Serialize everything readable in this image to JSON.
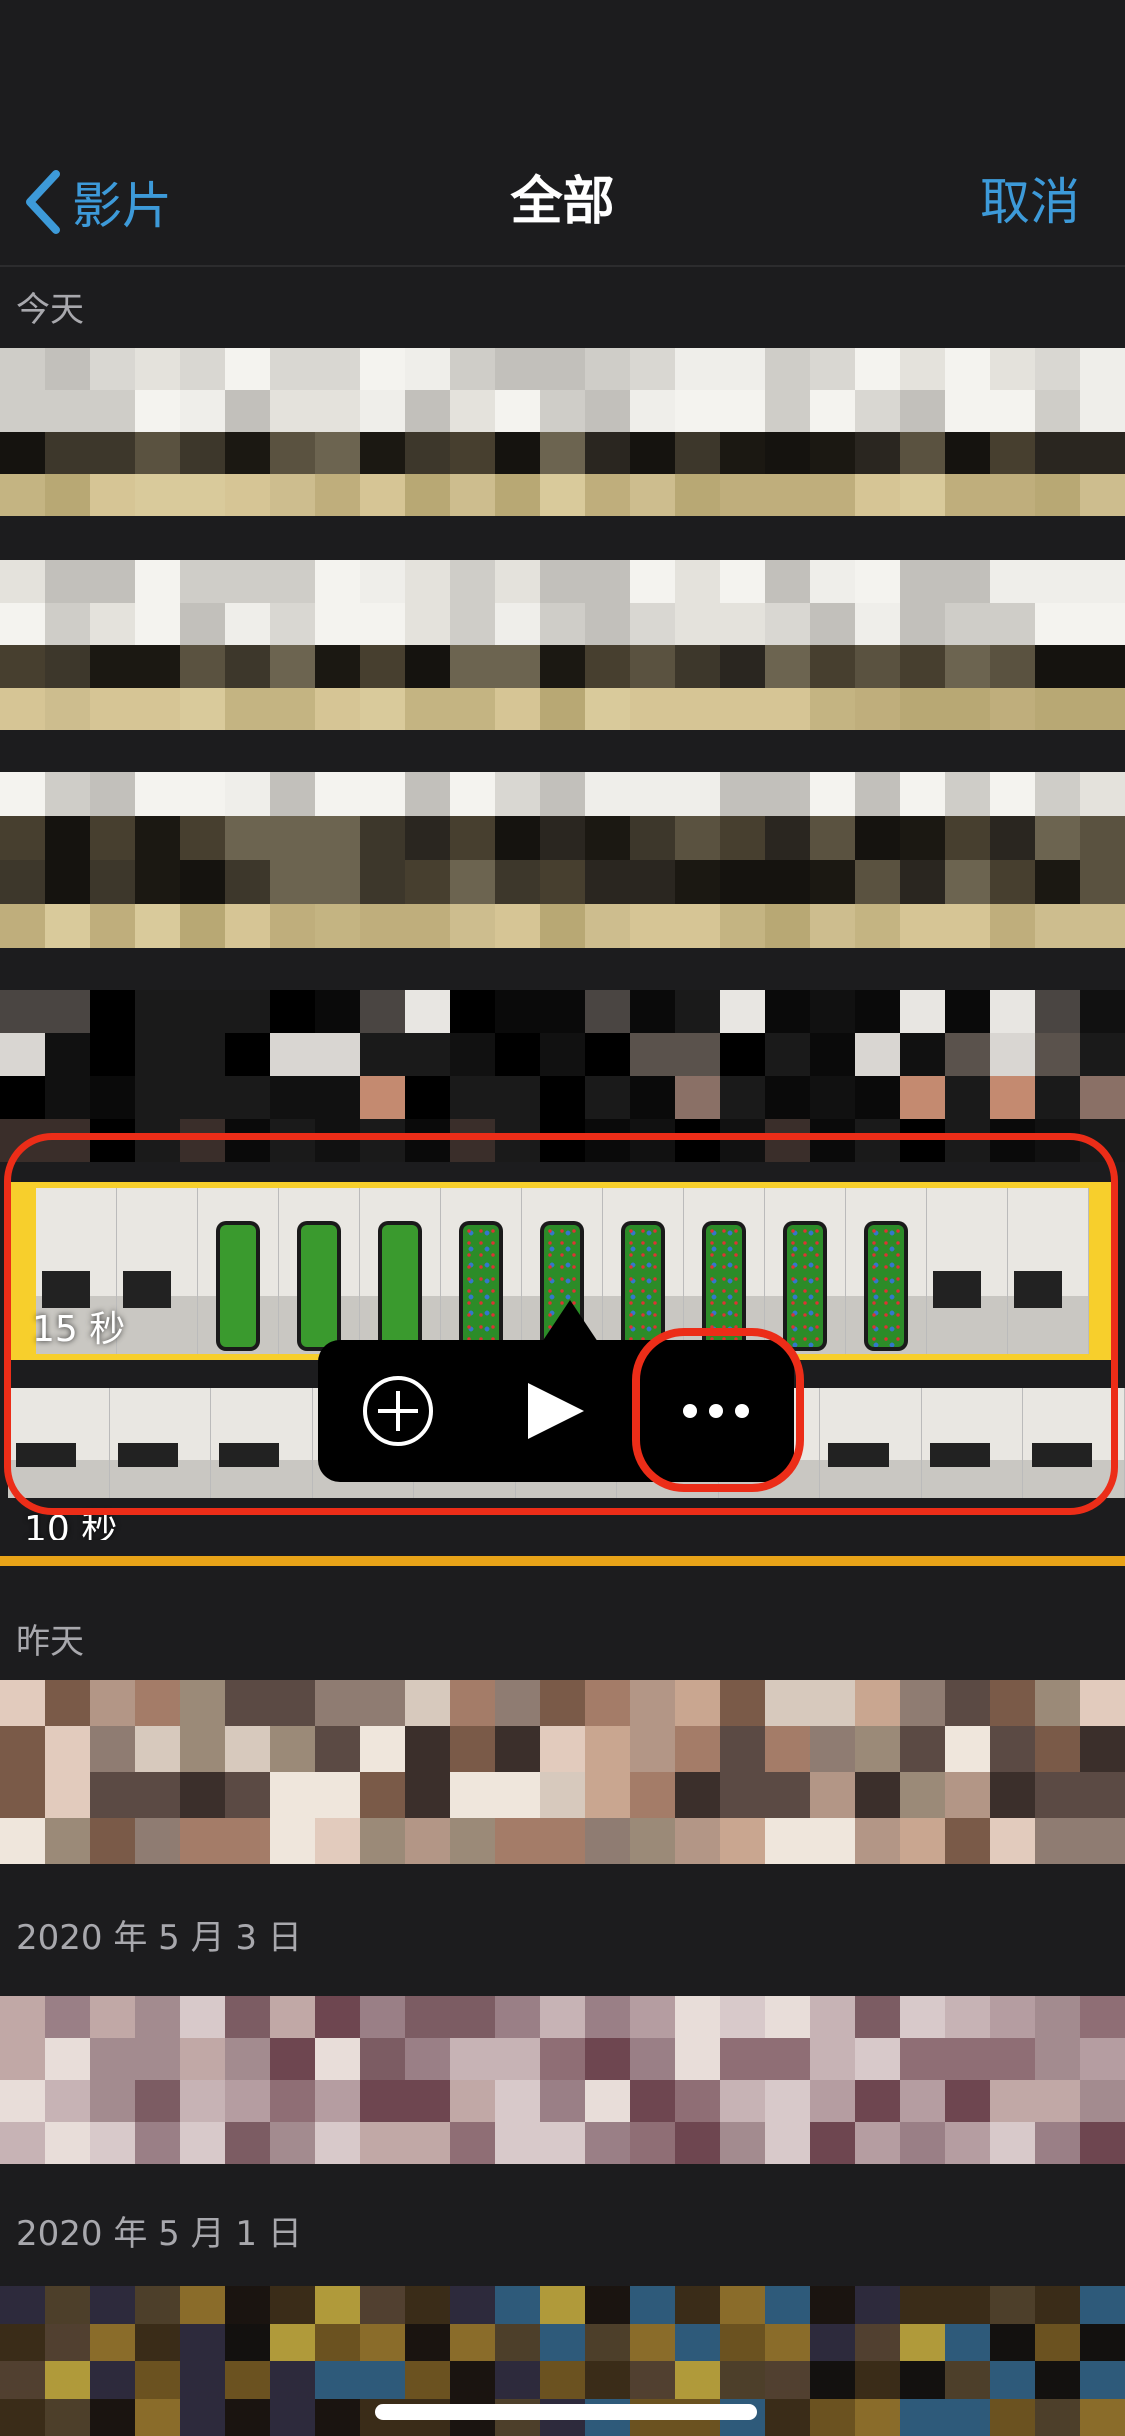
{
  "nav": {
    "back_label": "影片",
    "title": "全部",
    "cancel_label": "取消"
  },
  "sections": [
    {
      "header": "今天"
    },
    {
      "header": "昨天"
    },
    {
      "header": "2020 年 5 月 3 日"
    },
    {
      "header": "2020 年 5 月 1 日"
    }
  ],
  "clips": {
    "selected_duration": "15 秒",
    "next_duration": "10 秒"
  },
  "popup": {
    "add_icon": "plus-circle-icon",
    "play_icon": "play-icon",
    "more_icon": "ellipsis-icon"
  },
  "colors": {
    "accent": "#3d9ad9",
    "selection": "#f7cf2c",
    "annotation": "#ec2d18",
    "background": "#1c1c1e"
  }
}
